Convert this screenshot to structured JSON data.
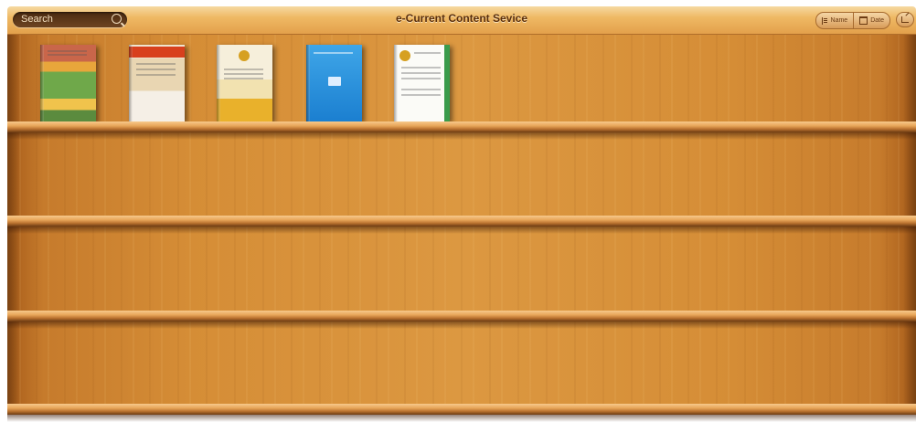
{
  "header": {
    "search_label": "Search",
    "title": "e-Current Content Sevice",
    "sort_name": "Name",
    "sort_date": "Date"
  },
  "icons": {
    "search": "search-icon",
    "sort_name": "list-icon",
    "sort_date": "calendar-icon",
    "share": "share-icon"
  },
  "books": [
    {
      "name": "journal-cover-1"
    },
    {
      "name": "journal-cover-2"
    },
    {
      "name": "journal-cover-3"
    },
    {
      "name": "journal-cover-4"
    },
    {
      "name": "journal-cover-5"
    }
  ],
  "colors": {
    "wood": "#dc9841",
    "topbar": "#efb964",
    "title_text": "#5a2f0d"
  }
}
